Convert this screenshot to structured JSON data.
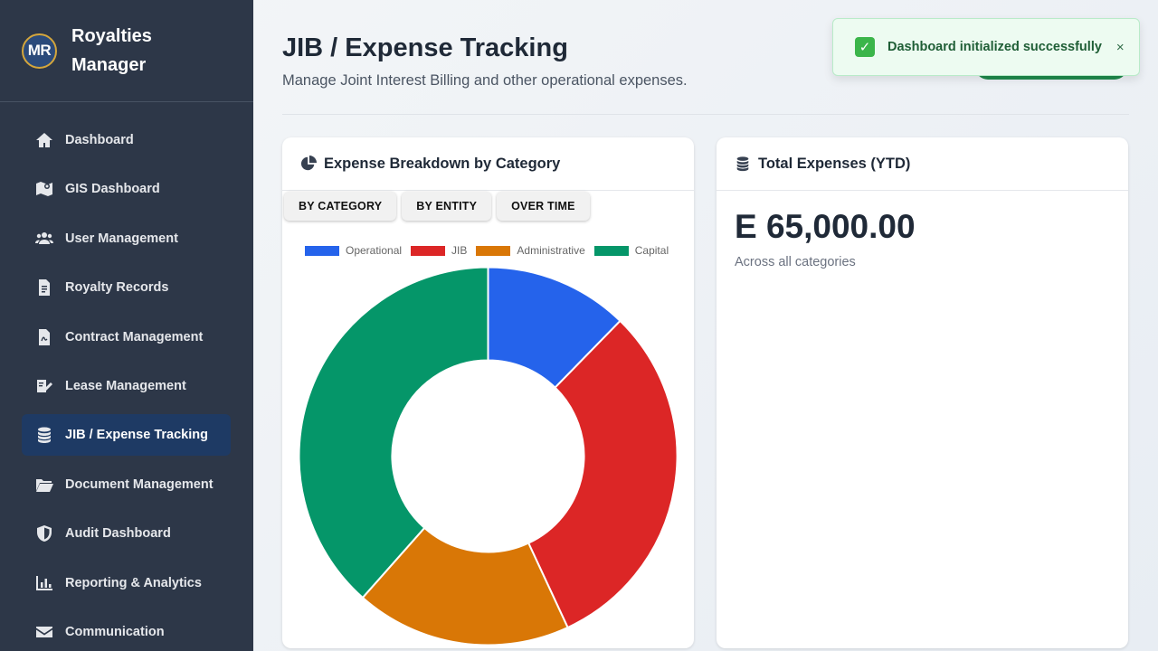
{
  "brand": {
    "logo_text": "MR",
    "name": "Royalties Manager"
  },
  "sidebar": {
    "items": [
      {
        "label": "Dashboard",
        "icon": "home-icon",
        "active": false
      },
      {
        "label": "GIS Dashboard",
        "icon": "map-icon",
        "active": false
      },
      {
        "label": "User Management",
        "icon": "users-icon",
        "active": false
      },
      {
        "label": "Royalty Records",
        "icon": "file-icon",
        "active": false
      },
      {
        "label": "Contract Management",
        "icon": "contract-icon",
        "active": false
      },
      {
        "label": "Lease Management",
        "icon": "lease-icon",
        "active": false
      },
      {
        "label": "JIB / Expense Tracking",
        "icon": "coins-icon",
        "active": true
      },
      {
        "label": "Document Management",
        "icon": "folder-icon",
        "active": false
      },
      {
        "label": "Audit Dashboard",
        "icon": "shield-icon",
        "active": false
      },
      {
        "label": "Reporting & Analytics",
        "icon": "chart-icon",
        "active": false
      },
      {
        "label": "Communication",
        "icon": "envelope-icon",
        "active": false
      }
    ]
  },
  "page": {
    "title": "JIB / Expense Tracking",
    "subtitle": "Manage Joint Interest Billing and other operational expenses."
  },
  "breakdown_card": {
    "title": "Expense Breakdown by Category",
    "icon": "pie-chart-icon",
    "tabs": [
      "BY CATEGORY",
      "BY ENTITY",
      "OVER TIME"
    ]
  },
  "total_card": {
    "title": "Total Expenses (YTD)",
    "icon": "coins-icon",
    "value": "E 65,000.00",
    "caption": "Across all categories"
  },
  "toast": {
    "icon": "check-icon",
    "message": "Dashboard initialized successfully",
    "close": "×"
  },
  "colors": {
    "operational": "#2563eb",
    "jib": "#dc2626",
    "administrative": "#d97706",
    "capital": "#059669"
  },
  "chart_data": {
    "type": "pie",
    "categories": [
      "Operational",
      "JIB",
      "Administrative",
      "Capital"
    ],
    "values": [
      8000,
      20000,
      12000,
      25000
    ],
    "colors": [
      "#2563eb",
      "#dc2626",
      "#d97706",
      "#059669"
    ],
    "legend": "top"
  }
}
